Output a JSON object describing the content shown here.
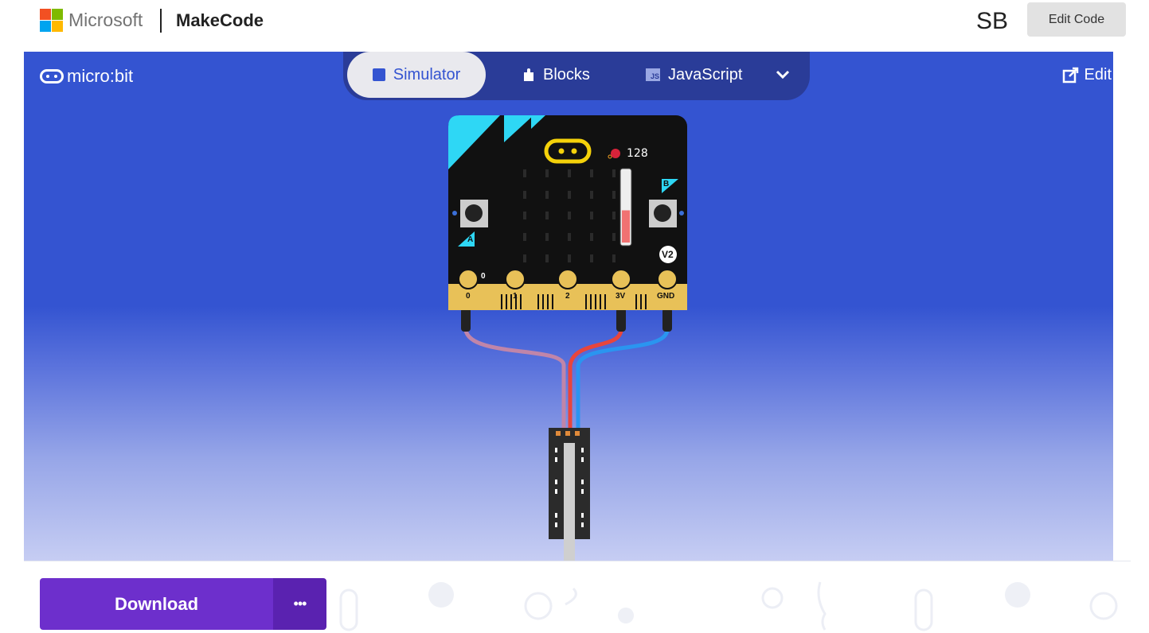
{
  "header": {
    "ms_brand": "Microsoft",
    "app_name": "MakeCode",
    "user_initials": "SB",
    "edit_code_label": "Edit Code",
    "ms_colors": [
      "#f25022",
      "#7fba00",
      "#00a4ef",
      "#ffb900"
    ]
  },
  "toolbar": {
    "logo_text": "micro:bit",
    "tabs": [
      {
        "label": "Simulator",
        "icon": "square-icon",
        "active": true
      },
      {
        "label": "Blocks",
        "icon": "puzzle-icon",
        "active": false
      },
      {
        "label": "JavaScript",
        "icon": "js-icon",
        "active": false
      }
    ],
    "edit_label": "Edit",
    "accent": "#3454d1"
  },
  "simulator": {
    "sound_level": "128",
    "button_a": "A",
    "button_b": "B",
    "version_badge": "V2",
    "pin_labels": [
      "0",
      "1",
      "2",
      "3V",
      "GND"
    ],
    "pin0_value": "0",
    "sound_meter_fill": 0.45
  },
  "footer": {
    "download_label": "Download",
    "more_label": "•••",
    "download_color": "#6d2fcc"
  }
}
